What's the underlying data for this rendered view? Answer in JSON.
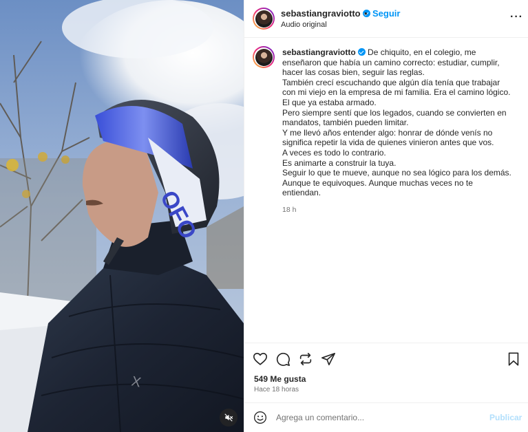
{
  "colors": {
    "accent": "#0095f6",
    "text": "#262626",
    "secondary": "#737373",
    "border": "#efefef",
    "publish_disabled": "#b2dffc"
  },
  "media": {
    "mute_icon": "muted-speaker-icon"
  },
  "header": {
    "username": "sebastiangraviotto",
    "verified_icon": "verified-badge-icon",
    "separator": "•",
    "follow_label": "Seguir",
    "audio_label": "Audio original",
    "more_icon": "more-options-icon"
  },
  "post": {
    "author": "sebastiangraviotto",
    "caption_lines": [
      "De chiquito, en el colegio, me",
      "enseñaron que había un camino correcto: estudiar, cumplir,",
      "hacer las cosas bien, seguir las reglas.",
      "También crecí escuchando que algún día tenía que trabajar",
      "con mi viejo en la empresa de mi familia. Era el camino lógico.",
      "El que ya estaba armado.",
      "Pero siempre sentí que los legados, cuando se convierten en",
      "mandatos, también pueden limitar.",
      "Y me llevó años entender algo: honrar de dónde venís no",
      "significa repetir la vida de quienes vinieron antes que vos.",
      "A veces es todo lo contrario.",
      "Es animarte a construir la tuya.",
      "Seguir lo que te mueve, aunque no sea lógico para los demás.",
      "Aunque te equivoques. Aunque muchas veces no te",
      "entiendan."
    ],
    "time_relative": "18 h"
  },
  "actions": {
    "like_icon": "heart-icon",
    "comment_icon": "comment-icon",
    "share_icon": "repost-icon",
    "send_icon": "send-icon",
    "save_icon": "bookmark-icon"
  },
  "stats": {
    "likes": "549 Me gusta",
    "posted_ago": "Hace 18 horas"
  },
  "comment": {
    "emoji_icon": "emoji-icon",
    "placeholder": "Agrega un comentario...",
    "publish_label": "Publicar"
  }
}
